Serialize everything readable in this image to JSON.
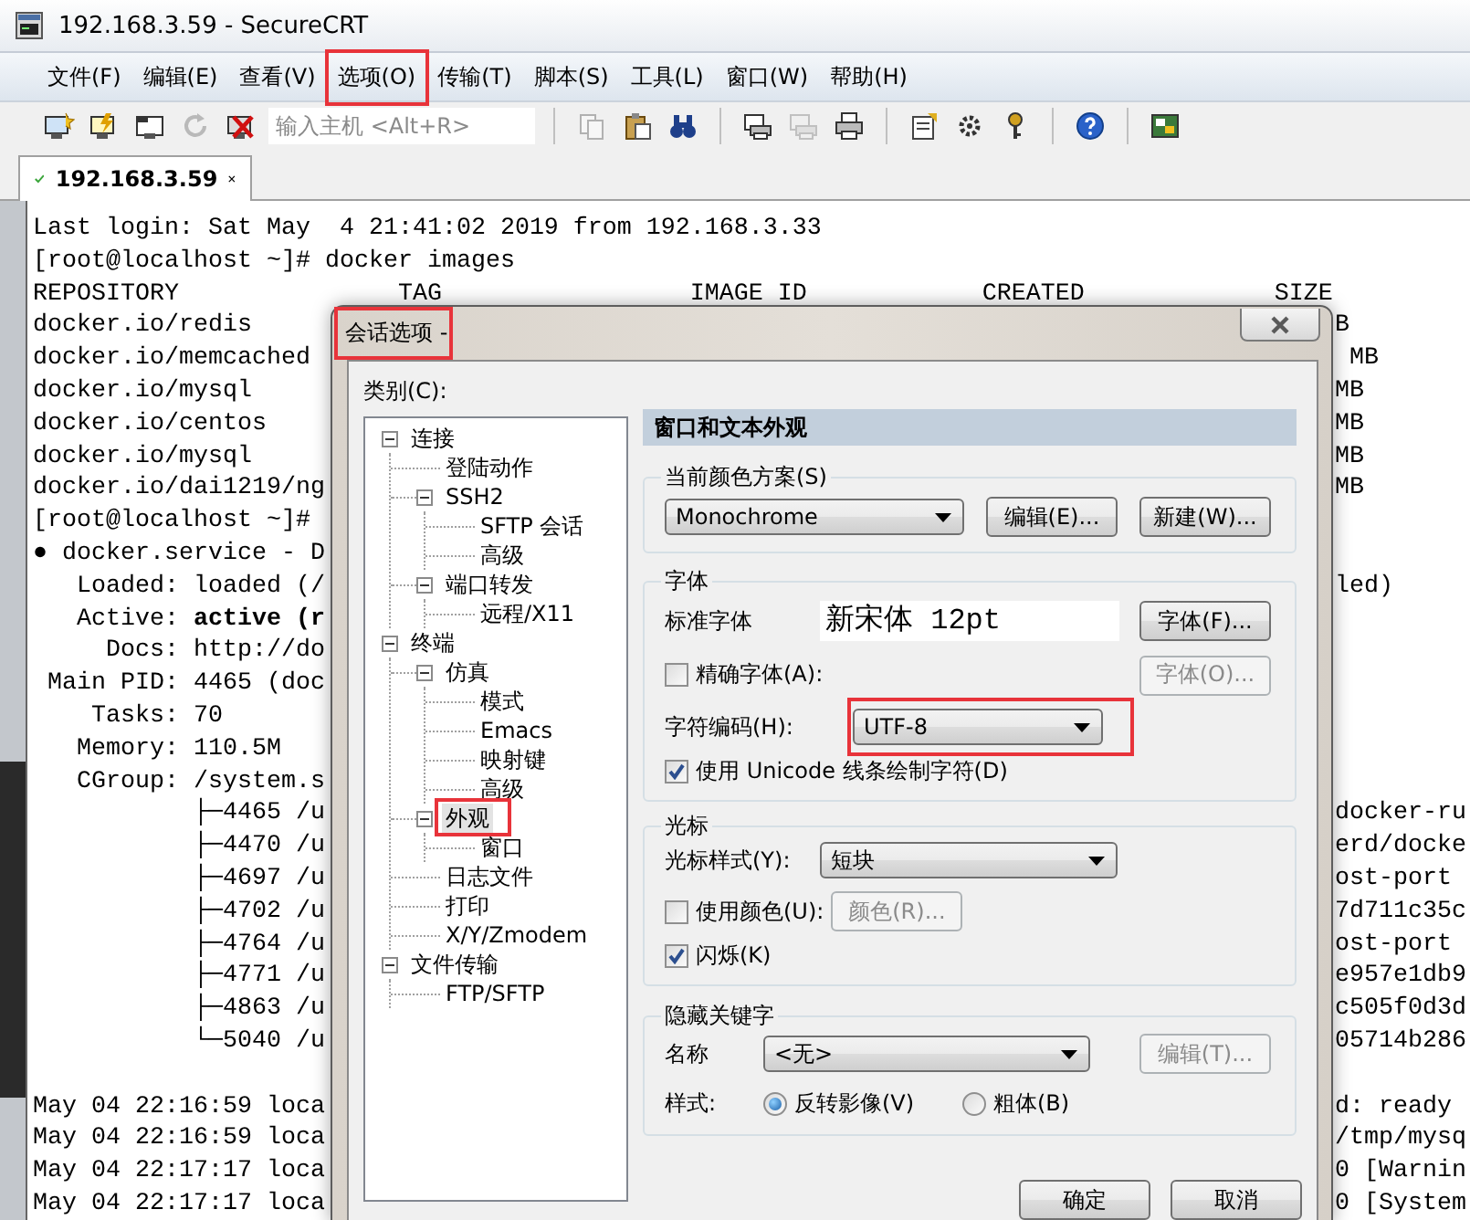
{
  "window": {
    "title": "192.168.3.59 - SecureCRT"
  },
  "menu": [
    {
      "label": "文件(F)",
      "annotated": false
    },
    {
      "label": "编辑(E)",
      "annotated": false
    },
    {
      "label": "查看(V)",
      "annotated": false
    },
    {
      "label": "选项(O)",
      "annotated": true
    },
    {
      "label": "传输(T)",
      "annotated": false
    },
    {
      "label": "脚本(S)",
      "annotated": false
    },
    {
      "label": "工具(L)",
      "annotated": false
    },
    {
      "label": "窗口(W)",
      "annotated": false
    },
    {
      "label": "帮助(H)",
      "annotated": false
    }
  ],
  "toolbar": {
    "items": [
      {
        "kind": "connect",
        "disabled": false
      },
      {
        "kind": "quick-connect",
        "disabled": false
      },
      {
        "kind": "connect-tab",
        "disabled": false
      },
      {
        "kind": "reconnect",
        "disabled": true
      },
      {
        "kind": "disconnect",
        "disabled": false
      },
      {
        "kind": "field",
        "placeholder": "输入主机 <Alt+R>"
      },
      {
        "kind": "separator"
      },
      {
        "kind": "copy",
        "disabled": true
      },
      {
        "kind": "paste",
        "disabled": false
      },
      {
        "kind": "find",
        "disabled": false
      },
      {
        "kind": "separator"
      },
      {
        "kind": "print-screen",
        "disabled": false
      },
      {
        "kind": "print-selection",
        "disabled": true
      },
      {
        "kind": "print",
        "disabled": false
      },
      {
        "kind": "separator"
      },
      {
        "kind": "session-options",
        "disabled": false
      },
      {
        "kind": "global-options",
        "disabled": false
      },
      {
        "kind": "keygen",
        "disabled": false
      },
      {
        "kind": "separator"
      },
      {
        "kind": "help",
        "disabled": false
      },
      {
        "kind": "separator"
      },
      {
        "kind": "sftp",
        "disabled": false
      }
    ]
  },
  "tabs": [
    {
      "label": "192.168.3.59",
      "selected": true,
      "connected": true
    }
  ],
  "terminal": {
    "lines": [
      {
        "kind": "text",
        "text": "Last login: Sat May  4 21:41:02 2019 from 192.168.3.33"
      },
      {
        "kind": "text",
        "text": "[root@localhost ~]# docker images"
      },
      {
        "kind": "text",
        "text": "REPOSITORY               TAG                 IMAGE ID            CREATED             SIZE"
      },
      {
        "kind": "text",
        "text": "docker.io/redis",
        "right": "B"
      },
      {
        "kind": "text",
        "text": "docker.io/memcached",
        "right": " MB"
      },
      {
        "kind": "text",
        "text": "docker.io/mysql",
        "right": "MB"
      },
      {
        "kind": "text",
        "text": "docker.io/centos",
        "right": "MB"
      },
      {
        "kind": "text",
        "text": "docker.io/mysql",
        "right": "MB"
      },
      {
        "kind": "text",
        "text": "docker.io/dai1219/ng",
        "right": "MB"
      },
      {
        "kind": "text",
        "text": "[root@localhost ~]#"
      },
      {
        "kind": "text",
        "text": "● docker.service - D"
      },
      {
        "kind": "text",
        "text": "   Loaded: loaded (/",
        "right": "led)"
      },
      {
        "kind": "text",
        "text": "   Active: **active (r**"
      },
      {
        "kind": "text",
        "text": "     Docs: http://do"
      },
      {
        "kind": "text",
        "text": " Main PID: 4465 (doc"
      },
      {
        "kind": "text",
        "text": "    Tasks: 70"
      },
      {
        "kind": "text",
        "text": "   Memory: 110.5M"
      },
      {
        "kind": "text",
        "text": "   CGroup: /system.s"
      },
      {
        "kind": "text",
        "text": "           ├─4465 /u",
        "right": "docker-ru"
      },
      {
        "kind": "text",
        "text": "           ├─4470 /u",
        "right": "erd/docke"
      },
      {
        "kind": "text",
        "text": "           ├─4697 /u",
        "right": "ost-port"
      },
      {
        "kind": "text",
        "text": "           ├─4702 /u",
        "right": "7d711c35c"
      },
      {
        "kind": "text",
        "text": "           ├─4764 /u",
        "right": "ost-port"
      },
      {
        "kind": "text",
        "text": "           ├─4771 /u",
        "right": "e957e1db9"
      },
      {
        "kind": "text",
        "text": "           ├─4863 /u",
        "right": "c505f0d3d"
      },
      {
        "kind": "text",
        "text": "           └─5040 /u",
        "right": "05714b286"
      },
      {
        "kind": "blank"
      },
      {
        "kind": "text",
        "text": "May 04 22:16:59 loca",
        "right": "d: ready"
      },
      {
        "kind": "text",
        "text": "May 04 22:16:59 loca",
        "right": "/tmp/mysq"
      },
      {
        "kind": "text",
        "text": "May 04 22:17:17 loca",
        "right": "0 [Warnin"
      },
      {
        "kind": "text",
        "text": "May 04 22:17:17 loca",
        "right": "0 [System"
      }
    ]
  },
  "dialog": {
    "title": "会话选项 -",
    "annotated": true,
    "category_label": "类别(C):",
    "tree": [
      {
        "label": "连接",
        "expanded": true,
        "selected": false,
        "annotated": false,
        "children": [
          {
            "label": "登陆动作",
            "selected": false,
            "annotated": false
          },
          {
            "label": "SSH2",
            "expanded": true,
            "selected": false,
            "annotated": false,
            "children": [
              {
                "label": "SFTP 会话",
                "selected": false,
                "annotated": false
              },
              {
                "label": "高级",
                "selected": false,
                "annotated": false
              }
            ]
          },
          {
            "label": "端口转发",
            "expanded": true,
            "selected": false,
            "annotated": false,
            "children": [
              {
                "label": "远程/X11",
                "selected": false,
                "annotated": false
              }
            ]
          }
        ]
      },
      {
        "label": "终端",
        "expanded": true,
        "selected": false,
        "annotated": false,
        "children": [
          {
            "label": "仿真",
            "expanded": true,
            "selected": false,
            "annotated": false,
            "children": [
              {
                "label": "模式",
                "selected": false,
                "annotated": false
              },
              {
                "label": "Emacs",
                "selected": false,
                "annotated": false
              },
              {
                "label": "映射键",
                "selected": false,
                "annotated": false
              },
              {
                "label": "高级",
                "selected": false,
                "annotated": false
              }
            ]
          },
          {
            "label": "外观",
            "expanded": true,
            "selected": true,
            "annotated": true,
            "children": [
              {
                "label": "窗口",
                "selected": false,
                "annotated": false
              }
            ]
          },
          {
            "label": "日志文件",
            "selected": false,
            "annotated": false
          },
          {
            "label": "打印",
            "selected": false,
            "annotated": false
          },
          {
            "label": "X/Y/Zmodem",
            "selected": false,
            "annotated": false
          }
        ]
      },
      {
        "label": "文件传输",
        "expanded": true,
        "selected": false,
        "annotated": false,
        "children": [
          {
            "label": "FTP/SFTP",
            "selected": false,
            "annotated": false
          }
        ]
      }
    ],
    "panel": {
      "header": "窗口和文本外观",
      "color_scheme": {
        "legend": "当前颜色方案(S)",
        "select": {
          "value": "Monochrome"
        },
        "buttons": [
          {
            "label": "编辑(E)...",
            "disabled": false
          },
          {
            "label": "新建(W)...",
            "disabled": false
          }
        ]
      },
      "font": {
        "legend": "字体",
        "standard_label": "标准字体",
        "preview": "新宋体 12pt",
        "font_button": {
          "label": "字体(F)...",
          "disabled": false
        },
        "precise": {
          "label": "精确字体(A):",
          "checked": false
        },
        "precise_button": {
          "label": "字体(O)...",
          "disabled": true
        },
        "encoding_label": "字符编码(H):",
        "encoding": {
          "value": "UTF-8",
          "annotated": true
        },
        "unicode_lines": {
          "label": "使用 Unicode 线条绘制字符(D)",
          "checked": true
        }
      },
      "cursor": {
        "legend": "光标",
        "style_label": "光标样式(Y):",
        "style": {
          "value": "短块"
        },
        "use_color": {
          "label": "使用颜色(U):",
          "checked": false
        },
        "color_button": {
          "label": "颜色(R)...",
          "disabled": true
        },
        "blink": {
          "label": "闪烁(K)",
          "checked": true
        }
      },
      "keywords": {
        "legend": "隐藏关键字",
        "name_label": "名称",
        "name": {
          "value": "<无>"
        },
        "edit_button": {
          "label": "编辑(T)...",
          "disabled": true
        },
        "style_label": "样式:",
        "styles": [
          {
            "label": "反转影像(V)",
            "selected": true
          },
          {
            "label": "粗体(B)",
            "selected": false
          }
        ]
      }
    },
    "buttons": [
      {
        "label": "确定"
      },
      {
        "label": "取消"
      }
    ]
  }
}
